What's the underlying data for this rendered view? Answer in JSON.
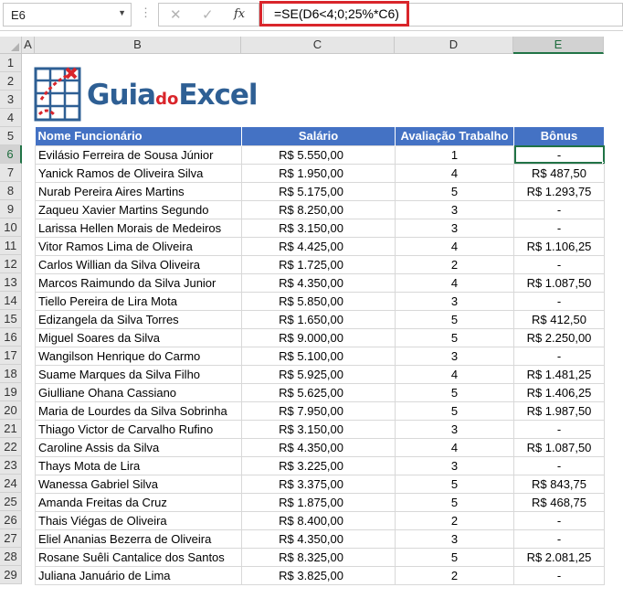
{
  "formula_bar": {
    "name_box": "E6",
    "fx_label": "fx",
    "formula": "=SE(D6<4;0;25%*C6)"
  },
  "columns": [
    "A",
    "B",
    "C",
    "D",
    "E"
  ],
  "rows": [
    "1",
    "2",
    "3",
    "4",
    "5",
    "6",
    "7",
    "8",
    "9",
    "10",
    "11",
    "12",
    "13",
    "14",
    "15",
    "16",
    "17",
    "18",
    "19",
    "20",
    "21",
    "22",
    "23",
    "24",
    "25",
    "26",
    "27",
    "28",
    "29"
  ],
  "logo": {
    "part1": "Guia",
    "part2": "do",
    "part3": "Excel"
  },
  "table": {
    "headers": [
      "Nome Funcionário",
      "Salário",
      "Avaliação Trabalho",
      "Bônus"
    ],
    "rows": [
      [
        "Evilásio Ferreira de Sousa Júnior",
        "R$ 5.550,00",
        "1",
        "-"
      ],
      [
        "Yanick Ramos de Oliveira Silva",
        "R$ 1.950,00",
        "4",
        "R$ 487,50"
      ],
      [
        "Nurab Pereira Aires Martins",
        "R$ 5.175,00",
        "5",
        "R$ 1.293,75"
      ],
      [
        "Zaqueu Xavier Martins Segundo",
        "R$ 8.250,00",
        "3",
        "-"
      ],
      [
        "Larissa Hellen Morais de Medeiros",
        "R$ 3.150,00",
        "3",
        "-"
      ],
      [
        "Vitor Ramos Lima de Oliveira",
        "R$ 4.425,00",
        "4",
        "R$ 1.106,25"
      ],
      [
        "Carlos Willian da Silva Oliveira",
        "R$ 1.725,00",
        "2",
        "-"
      ],
      [
        "Marcos Raimundo da Silva Junior",
        "R$ 4.350,00",
        "4",
        "R$ 1.087,50"
      ],
      [
        "Tiello Pereira de Lira Mota",
        "R$ 5.850,00",
        "3",
        "-"
      ],
      [
        "Edizangela da Silva Torres",
        "R$ 1.650,00",
        "5",
        "R$ 412,50"
      ],
      [
        "Miguel Soares da Silva",
        "R$ 9.000,00",
        "5",
        "R$ 2.250,00"
      ],
      [
        "Wangilson Henrique do Carmo",
        "R$ 5.100,00",
        "3",
        "-"
      ],
      [
        "Suame Marques da Silva Filho",
        "R$ 5.925,00",
        "4",
        "R$ 1.481,25"
      ],
      [
        "Giulliane Ohana Cassiano",
        "R$ 5.625,00",
        "5",
        "R$ 1.406,25"
      ],
      [
        "Maria de Lourdes da Silva Sobrinha",
        "R$ 7.950,00",
        "5",
        "R$ 1.987,50"
      ],
      [
        "Thiago Victor de Carvalho Rufino",
        "R$ 3.150,00",
        "3",
        "-"
      ],
      [
        "Caroline Assis da Silva",
        "R$ 4.350,00",
        "4",
        "R$ 1.087,50"
      ],
      [
        "Thays Mota de Lira",
        "R$ 3.225,00",
        "3",
        "-"
      ],
      [
        "Wanessa Gabriel Silva",
        "R$ 3.375,00",
        "5",
        "R$ 843,75"
      ],
      [
        "Amanda Freitas da Cruz",
        "R$ 1.875,00",
        "5",
        "R$ 468,75"
      ],
      [
        "Thais Viégas de Oliveira",
        "R$ 8.400,00",
        "2",
        "-"
      ],
      [
        "Eliel Ananias Bezerra de Oliveira",
        "R$ 4.350,00",
        "3",
        "-"
      ],
      [
        "Rosane Suêli Cantalice dos Santos",
        "R$ 8.325,00",
        "5",
        "R$ 2.081,25"
      ],
      [
        "Juliana Januário de Lima",
        "R$ 3.825,00",
        "2",
        "-"
      ]
    ]
  },
  "colors": {
    "header_fill": "#4472c4",
    "selection": "#217346",
    "formula_highlight": "#d9252b",
    "logo_blue": "#2e5f94"
  },
  "icons": {
    "cancel": "close-icon",
    "enter": "check-icon",
    "function": "fx-icon",
    "name_box_dropdown": "chevron-down-icon",
    "logo": "spreadsheet-logo-icon"
  }
}
